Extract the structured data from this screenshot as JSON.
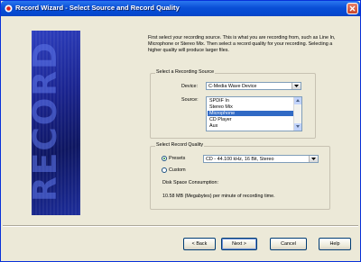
{
  "window": {
    "title": "Record Wizard - Select Source and Record Quality"
  },
  "side_image": {
    "text": "RECORD"
  },
  "description": "First select your recording source. This is what you are recording from, such as Line In, Microphone or Stereo Mix. Then select a record quality for your recording. Selecting a higher quality will produce larger files.",
  "source_group": {
    "label": "Select a Recording Source",
    "device_label": "Device:",
    "device_value": "C-Media Wave Device",
    "source_label": "Source:",
    "sources": [
      "SPDIF In",
      "Stereo Mix",
      "Microphone",
      "CD Player",
      "Aux"
    ],
    "selected_source": "Microphone"
  },
  "quality_group": {
    "label": "Select Record Quality",
    "presets_label": "Presets",
    "presets_value": "CD - 44.100 kHz, 16 Bit, Stereo",
    "custom_label": "Custom",
    "disk_space_label": "Disk Space Consumption:",
    "disk_space_value": "10.58 MB (Megabytes) per minute of recording time."
  },
  "buttons": {
    "back": "< Back",
    "next": "Next >",
    "cancel": "Cancel",
    "help": "Help"
  }
}
